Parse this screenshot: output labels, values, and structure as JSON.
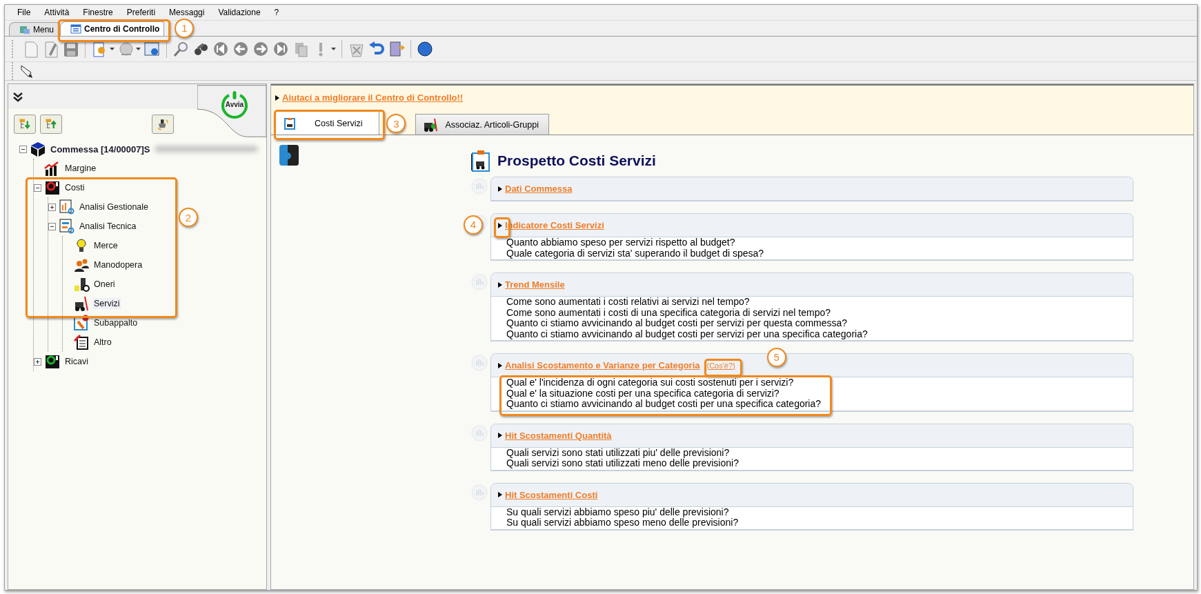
{
  "menu_bar": [
    {
      "label": "File"
    },
    {
      "label": "Attività"
    },
    {
      "label": "Finestre"
    },
    {
      "label": "Preferiti"
    },
    {
      "label": "Messaggi"
    },
    {
      "label": "Validazione"
    },
    {
      "label": "?"
    }
  ],
  "window_tabs": [
    {
      "label": "Menu",
      "selected": false
    },
    {
      "label": "Centro di Controllo",
      "selected": true
    }
  ],
  "sidebar": {
    "start_button": "Avvia",
    "tree": [
      {
        "label": "Commessa [14/00007]S",
        "bold": true,
        "expanded": true,
        "selected": false,
        "children": [
          {
            "label": "Margine",
            "selected": false
          },
          {
            "label": "Costi",
            "expanded": true,
            "selected": false,
            "children": [
              {
                "label": "Analisi Gestionale",
                "expanded": false,
                "selected": false
              },
              {
                "label": "Analisi Tecnica",
                "expanded": true,
                "selected": false,
                "children": [
                  {
                    "label": "Merce",
                    "selected": false
                  },
                  {
                    "label": "Manodopera",
                    "selected": false
                  },
                  {
                    "label": "Oneri",
                    "selected": false
                  },
                  {
                    "label": "Servizi",
                    "selected": true
                  },
                  {
                    "label": "Subappalto",
                    "selected": false
                  },
                  {
                    "label": "Altro",
                    "selected": false
                  }
                ]
              }
            ]
          },
          {
            "label": "Ricavi",
            "expanded": false,
            "selected": false
          }
        ]
      }
    ]
  },
  "help_link": "Aiutaci a migliorare il Centro di Controllo!!",
  "content_tabs": [
    {
      "label": "Costi Servizi",
      "selected": true
    },
    {
      "label": "Associaz. Articoli-Gruppi",
      "selected": false
    }
  ],
  "page_title": "Prospetto Costi Servizi",
  "sections": [
    {
      "title": "Dati Commessa"
    },
    {
      "title": "Indicatore Costi Servizi",
      "lines": [
        "Quanto abbiamo speso per servizi rispetto al budget?",
        "Quale categoria di servizi sta' superando il budget di spesa?"
      ]
    },
    {
      "title": "Trend Mensile",
      "lines": [
        "Come sono aumentati i costi relativi ai servizi nel tempo?",
        "Come sono aumentati i costi di una specifica categoria di servizi nel tempo?",
        "Quanto ci stiamo avvicinando al budget costi per servizi per questa commessa?",
        "Quanto ci stiamo avvicinando al budget costi per servizi per una specifica categoria?"
      ]
    },
    {
      "title": "Analisi Scostamento e Varianze per Categoria",
      "info_link": "(Cos'é?)",
      "lines": [
        "Qual e' l'incidenza di ogni categoria sui costi sostenuti per i servizi?",
        "Qual e' la situazione costi per una specifica categoria di servizi?",
        "Quanto ci stiamo avvicinando al budget costi per una specifica categoria?"
      ]
    },
    {
      "title": "Hit Scostamenti Quantità",
      "lines": [
        "Quali servizi sono stati utilizzati piu' delle previsioni?",
        "Quali servizi sono stati utilizzati meno delle previsioni?"
      ]
    },
    {
      "title": "Hit Scostamenti Costi",
      "lines": [
        "Su quali servizi abbiamo speso piu' delle previsioni?",
        "Su quali servizi abbiamo speso meno delle previsioni?"
      ]
    }
  ],
  "callouts": [
    {
      "label": "1"
    },
    {
      "label": "2"
    },
    {
      "label": "3"
    },
    {
      "label": "4"
    },
    {
      "label": "5"
    }
  ]
}
